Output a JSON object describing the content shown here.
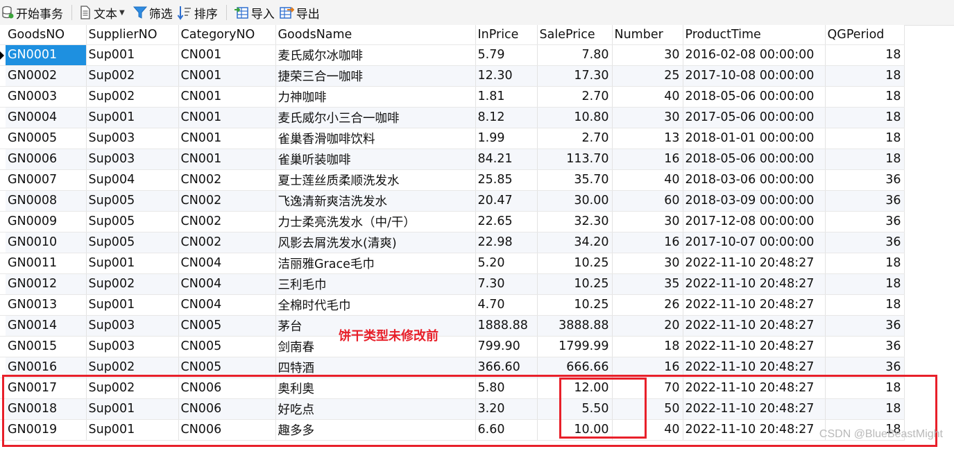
{
  "toolbar": {
    "begin_transaction": "开始事务",
    "text": "文本",
    "filter": "筛选",
    "sort": "排序",
    "import": "导入",
    "export": "导出"
  },
  "columns": [
    "GoodsNO",
    "SupplierNO",
    "CategoryNO",
    "GoodsName",
    "InPrice",
    "SalePrice",
    "Number",
    "ProductTime",
    "QGPeriod"
  ],
  "rows": [
    [
      "GN0001",
      "Sup001",
      "CN001",
      "麦氏威尔冰咖啡",
      "5.79",
      "7.80",
      "30",
      "2016-02-08 00:00:00",
      "18"
    ],
    [
      "GN0002",
      "Sup002",
      "CN001",
      "捷荣三合一咖啡",
      "12.30",
      "17.30",
      "25",
      "2017-10-08 00:00:00",
      "18"
    ],
    [
      "GN0003",
      "Sup002",
      "CN001",
      "力神咖啡",
      "1.81",
      "2.70",
      "40",
      "2018-05-06 00:00:00",
      "18"
    ],
    [
      "GN0004",
      "Sup001",
      "CN001",
      "麦氏威尔小三合一咖啡",
      "8.12",
      "10.80",
      "30",
      "2017-05-06 00:00:00",
      "18"
    ],
    [
      "GN0005",
      "Sup003",
      "CN001",
      "雀巢香滑咖啡饮料",
      "1.99",
      "2.70",
      "13",
      "2018-01-01 00:00:00",
      "18"
    ],
    [
      "GN0006",
      "Sup003",
      "CN001",
      "雀巢听装咖啡",
      "84.21",
      "113.70",
      "16",
      "2018-05-06 00:00:00",
      "18"
    ],
    [
      "GN0007",
      "Sup004",
      "CN002",
      "夏士莲丝质柔顺洗发水",
      "25.85",
      "35.70",
      "40",
      "2018-03-06 00:00:00",
      "36"
    ],
    [
      "GN0008",
      "Sup005",
      "CN002",
      "飞逸清新爽洁洗发水",
      "20.47",
      "30.00",
      "60",
      "2018-03-09 00:00:00",
      "36"
    ],
    [
      "GN0009",
      "Sup005",
      "CN002",
      "力士柔亮洗发水（中/干）",
      "22.65",
      "32.30",
      "30",
      "2017-12-08 00:00:00",
      "36"
    ],
    [
      "GN0010",
      "Sup005",
      "CN002",
      "风影去屑洗发水(清爽)",
      "22.98",
      "34.20",
      "16",
      "2017-10-07 00:00:00",
      "36"
    ],
    [
      "GN0011",
      "Sup001",
      "CN004",
      "洁丽雅Grace毛巾",
      "5.20",
      "10.25",
      "30",
      "2022-11-10 20:48:27",
      "18"
    ],
    [
      "GN0012",
      "Sup002",
      "CN004",
      "三利毛巾",
      "7.30",
      "10.25",
      "35",
      "2022-11-10 20:48:27",
      "18"
    ],
    [
      "GN0013",
      "Sup001",
      "CN004",
      "全棉时代毛巾",
      "4.70",
      "10.25",
      "26",
      "2022-11-10 20:48:27",
      "18"
    ],
    [
      "GN0014",
      "Sup003",
      "CN005",
      "茅台",
      "1888.88",
      "3888.88",
      "20",
      "2022-11-10 20:48:27",
      "36"
    ],
    [
      "GN0015",
      "Sup003",
      "CN005",
      "剑南春",
      "799.90",
      "1799.99",
      "18",
      "2022-11-10 20:48:27",
      "36"
    ],
    [
      "GN0016",
      "Sup002",
      "CN005",
      "四特酒",
      "366.60",
      "666.66",
      "16",
      "2022-11-10 20:48:27",
      "36"
    ],
    [
      "GN0017",
      "Sup002",
      "CN006",
      "奥利奥",
      "5.80",
      "12.00",
      "70",
      "2022-11-10 20:48:27",
      "18"
    ],
    [
      "GN0018",
      "Sup001",
      "CN006",
      "好吃点",
      "3.20",
      "5.50",
      "50",
      "2022-11-10 20:48:27",
      "18"
    ],
    [
      "GN0019",
      "Sup001",
      "CN006",
      "趣多多",
      "6.60",
      "10.00",
      "40",
      "2022-11-10 20:48:27",
      "18"
    ]
  ],
  "annotation": "饼干类型未修改前",
  "watermark": "CSDN @BlueBeastMight",
  "colors": {
    "selection": "#1e90e0",
    "annotation_red": "#e8202a",
    "alt_row": "#f5f7fb"
  }
}
